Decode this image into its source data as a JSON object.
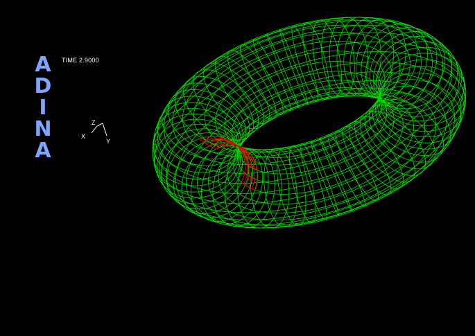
{
  "logo": {
    "letters": [
      "A",
      "D",
      "I",
      "N",
      "A"
    ],
    "color": "#7fa6ff"
  },
  "time": {
    "label": "TIME 2.9000"
  },
  "triad": {
    "axes": {
      "x": "X",
      "y": "Y",
      "z": "Z"
    }
  },
  "model": {
    "mesh_color": "#00e000",
    "highlight_color": "#e00000",
    "background": "#000000"
  }
}
